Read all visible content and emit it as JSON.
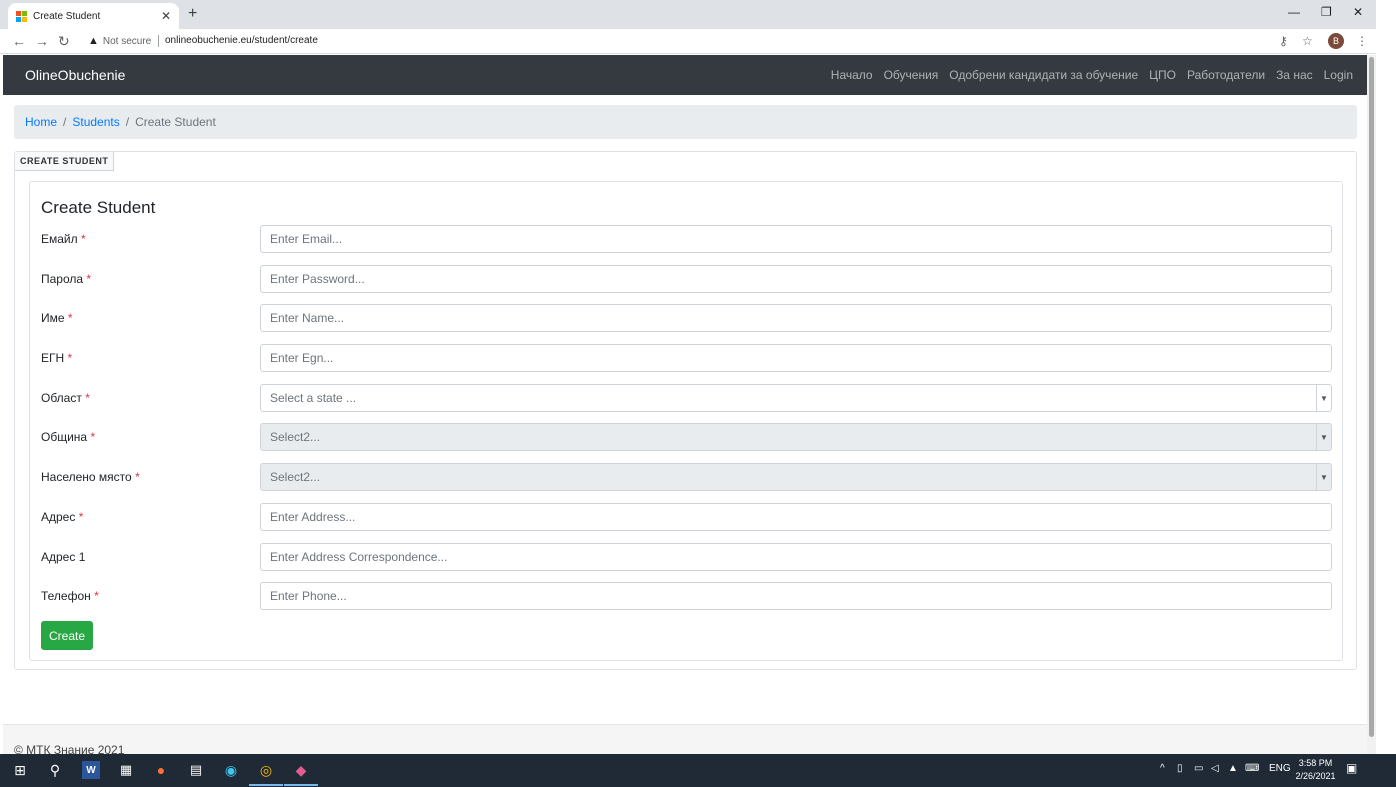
{
  "browser": {
    "tab_title": "Create Student",
    "security_label": "Not secure",
    "url": "onlineobuchenie.eu/student/create",
    "profile_initial": "B"
  },
  "navbar": {
    "brand": "OlineObuchenie",
    "links": [
      "Начало",
      "Обучения",
      "Одобрени кандидати за обучение",
      "ЦПО",
      "Работодатели",
      "За нас",
      "Login"
    ]
  },
  "breadcrumb": {
    "home": "Home",
    "students": "Students",
    "current": "Create Student"
  },
  "panel": {
    "tab_label": "CREATE STUDENT",
    "heading": "Create Student"
  },
  "form": {
    "fields": [
      {
        "label": "Емайл",
        "required": "*",
        "placeholder": "Enter Email..."
      },
      {
        "label": "Парола",
        "required": "*",
        "placeholder": "Enter Password..."
      },
      {
        "label": "Име",
        "required": "*",
        "placeholder": "Enter Name..."
      },
      {
        "label": "ЕГН",
        "required": "*",
        "placeholder": "Enter Egn..."
      },
      {
        "label": "Област",
        "required": "*",
        "placeholder": "Select a state ..."
      },
      {
        "label": "Община",
        "required": "*",
        "placeholder": "Select2..."
      },
      {
        "label": "Населено място",
        "required": "*",
        "placeholder": "Select2..."
      },
      {
        "label": "Адрес",
        "required": "*",
        "placeholder": "Enter Address..."
      },
      {
        "label": "Адрес 1",
        "required": "",
        "placeholder": "Enter Address Correspondence..."
      },
      {
        "label": "Телефон",
        "required": "*",
        "placeholder": "Enter Phone..."
      }
    ],
    "submit_label": "Create"
  },
  "footer": {
    "text": "© МТК Знание 2021"
  },
  "taskbar": {
    "lang": "ENG",
    "time": "3:58 PM",
    "date": "2/26/2021"
  },
  "colors": {
    "navbar": "#343a40",
    "link": "#007bff",
    "required": "#dc3545",
    "submit": "#28a745"
  }
}
